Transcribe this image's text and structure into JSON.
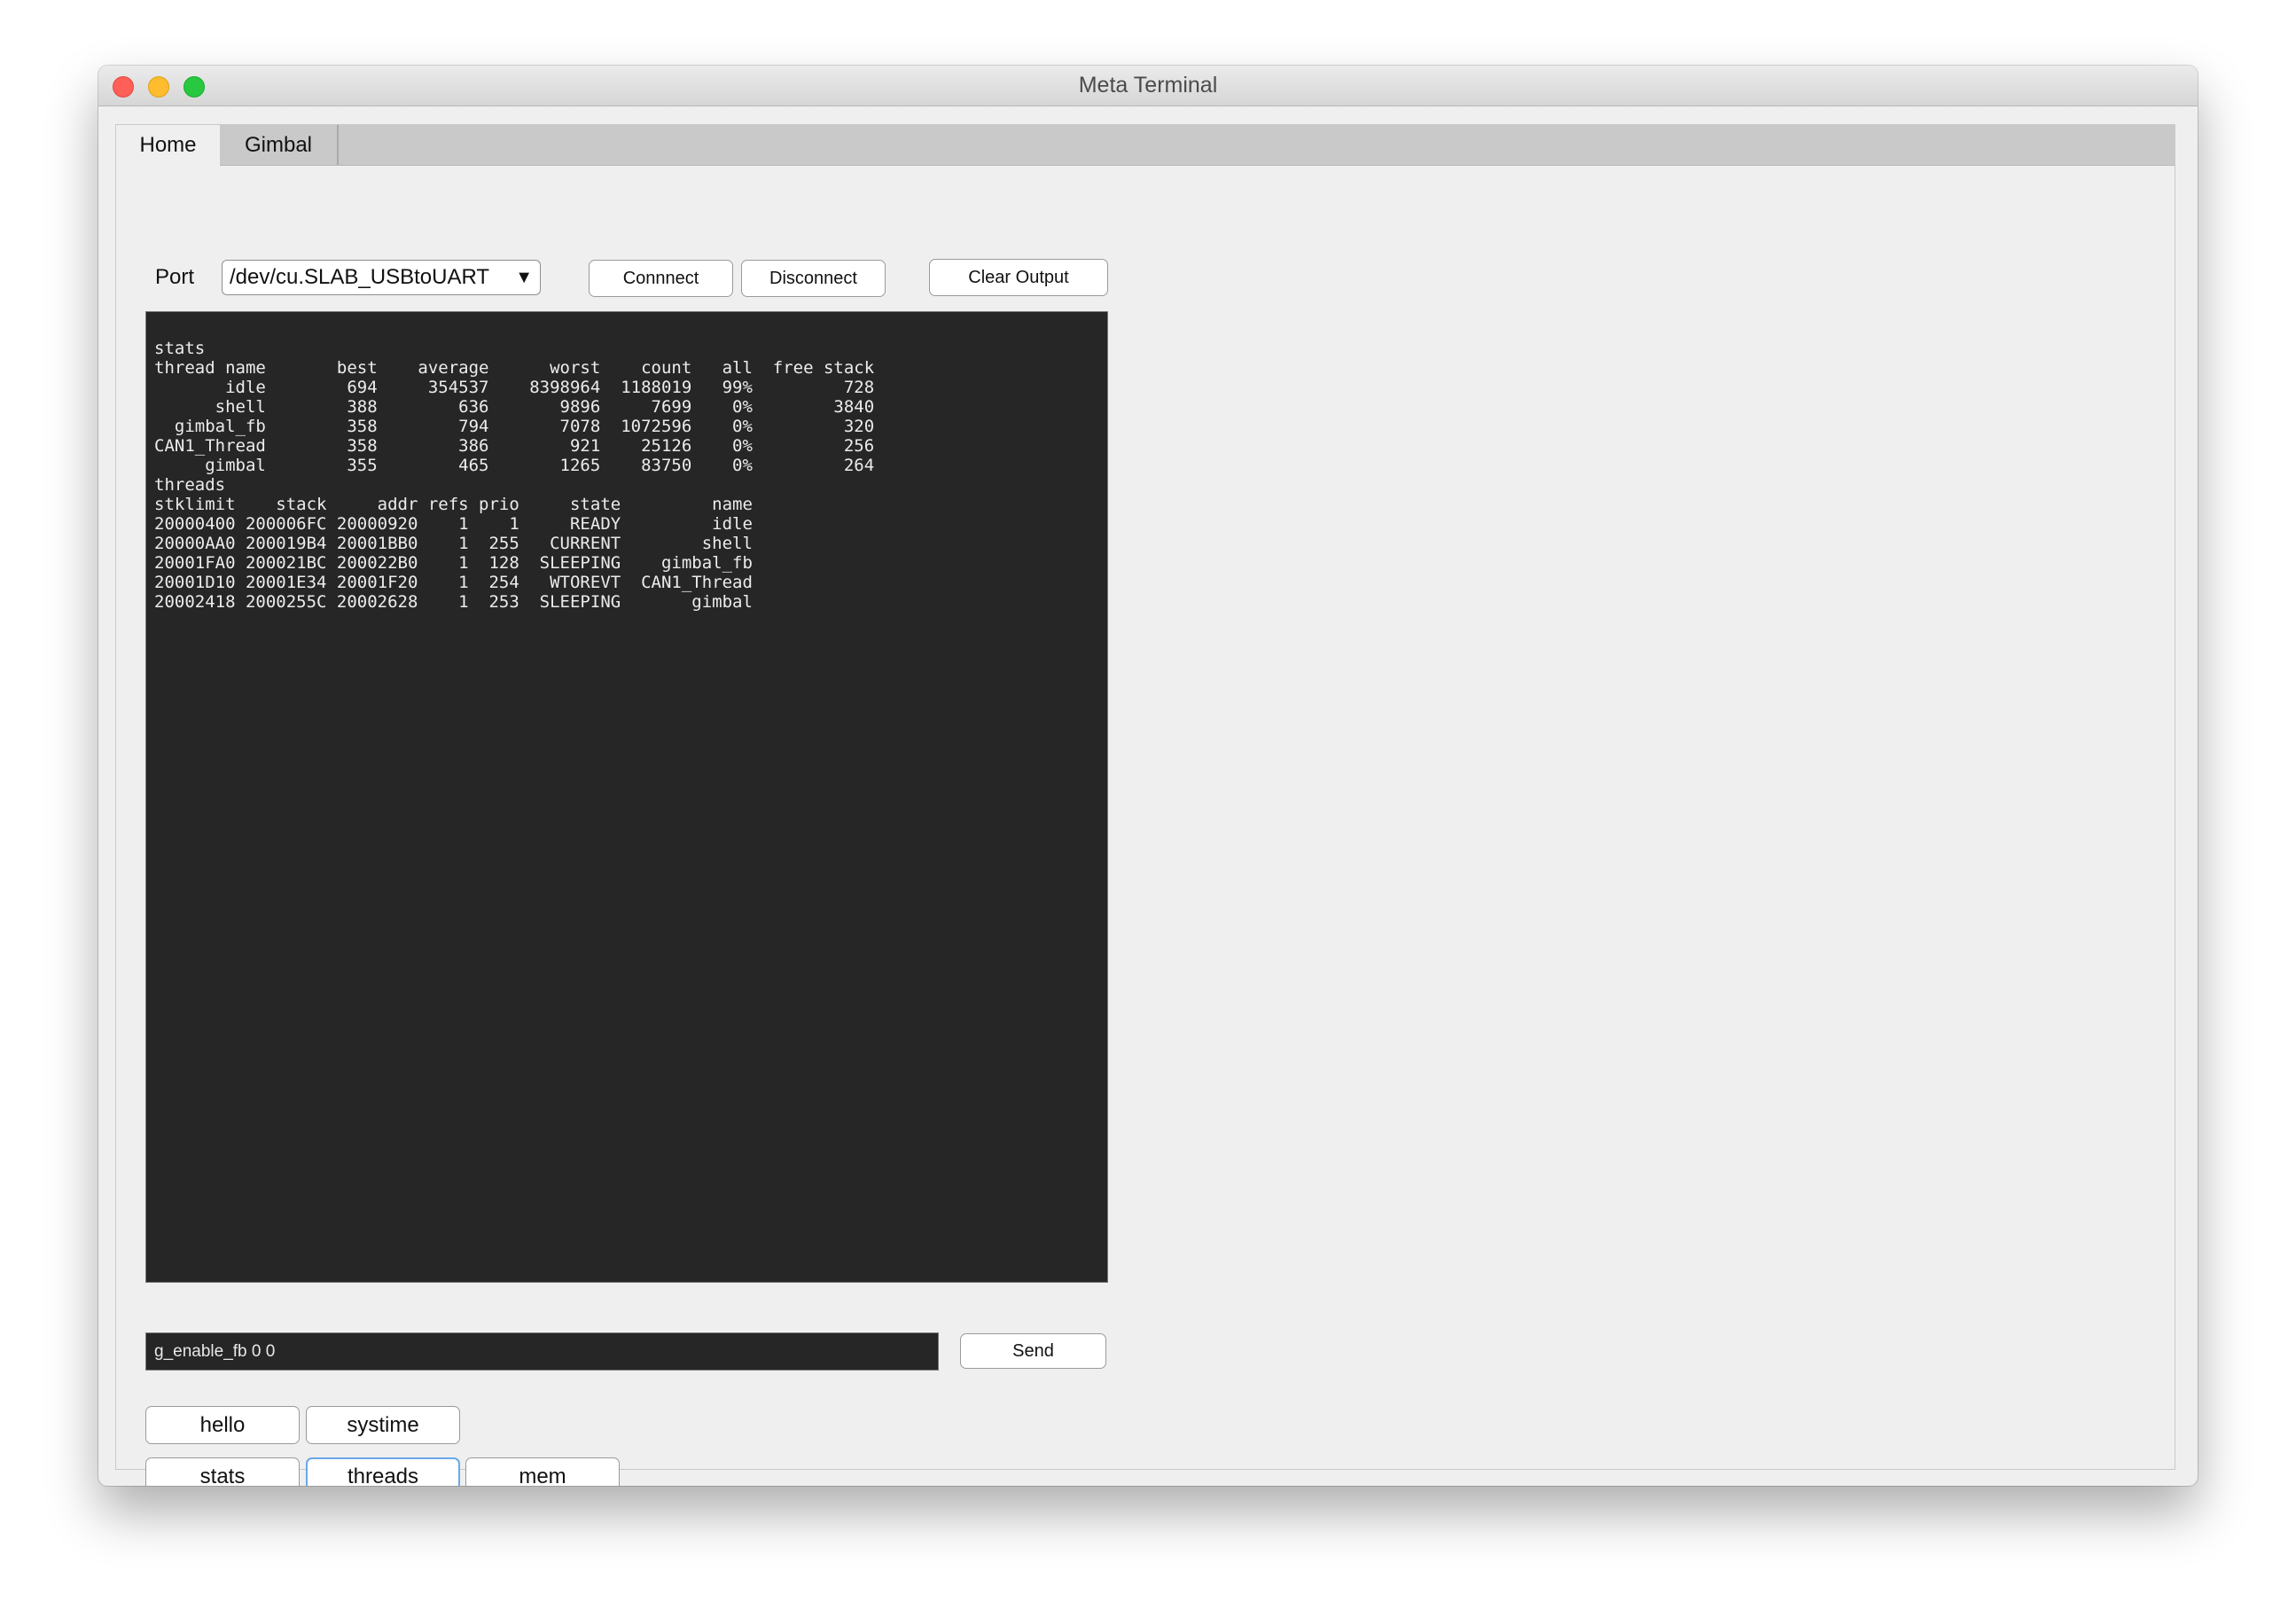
{
  "window": {
    "title": "Meta Terminal"
  },
  "tabs": [
    {
      "label": "Home",
      "active": true
    },
    {
      "label": "Gimbal",
      "active": false
    }
  ],
  "port": {
    "label": "Port",
    "selected": "/dev/cu.SLAB_USBtoUART"
  },
  "buttons": {
    "connect": "Connnect",
    "disconnect": "Disconnect",
    "clear_output": "Clear Output",
    "send": "Send"
  },
  "terminal": {
    "lines": [
      "stats",
      "thread name       best    average      worst    count   all  free stack",
      "       idle        694     354537    8398964  1188019   99%         728",
      "      shell        388        636       9896     7699    0%        3840",
      "  gimbal_fb        358        794       7078  1072596    0%         320",
      "CAN1_Thread        358        386        921    25126    0%         256",
      "     gimbal        355        465       1265    83750    0%         264",
      "threads",
      "stklimit    stack     addr refs prio     state         name",
      "20000400 200006FC 20000920    1    1     READY         idle",
      "20000AA0 200019B4 20001BB0    1  255   CURRENT        shell",
      "20001FA0 200021BC 200022B0    1  128  SLEEPING    gimbal_fb",
      "20001D10 20001E34 20001F20    1  254   WTOREVT  CAN1_Thread",
      "20002418 2000255C 20002628    1  253  SLEEPING       gimbal"
    ]
  },
  "command_input": {
    "value": "g_enable_fb 0 0"
  },
  "quick_commands": {
    "row1": [
      "hello",
      "systime"
    ],
    "row2": [
      "stats",
      "threads",
      "mem"
    ]
  },
  "icons": {
    "close": "close-icon",
    "minimize": "minimize-icon",
    "maximize": "maximize-icon",
    "dropdown": "chevron-down-icon"
  },
  "colors": {
    "terminal_bg": "#262626",
    "terminal_fg": "#ececec",
    "focus_ring": "#6aa8e8"
  }
}
